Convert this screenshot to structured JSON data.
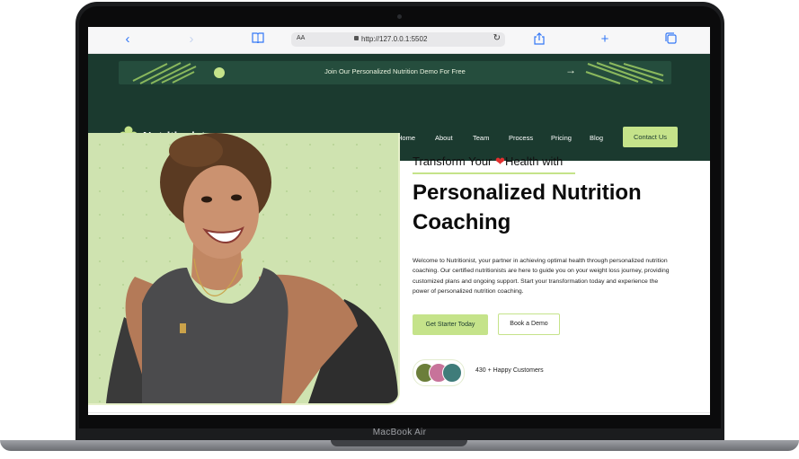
{
  "device": {
    "label": "MacBook Air"
  },
  "browser": {
    "text_size_label": "AA",
    "url": "http://127.0.0.1:5502",
    "icons": [
      "back-icon",
      "forward-icon",
      "book-icon",
      "reload-icon",
      "share-icon",
      "plus-icon",
      "tabs-icon"
    ]
  },
  "promo": {
    "text": "Join Our Personalized Nutrition Demo For Free",
    "arrow": "→"
  },
  "header": {
    "brand": "Nutritionist",
    "nav": [
      "Home",
      "About",
      "Team",
      "Process",
      "Pricing",
      "Blog"
    ],
    "contact_label": "Contact Us"
  },
  "hero": {
    "kicker_before": "Transform Your",
    "kicker_after": "Health with",
    "headline_line1": "Personalized Nutrition",
    "headline_line2": "Coaching",
    "description": "Welcome to Nutritionist, your partner in achieving optimal health through personalized nutrition coaching. Our certified nutritionists are here to guide you on your weight loss journey, providing customized plans and ongoing support. Start your transformation today and experience the power of personalized nutrition coaching.",
    "cta_primary": "Get Starter Today",
    "cta_secondary": "Book a Demo",
    "customers": "430 + Happy Customers"
  },
  "colors": {
    "brand_dark": "#1b3a2f",
    "accent": "#c5e38a",
    "hero_bg": "#cfe3b0"
  }
}
